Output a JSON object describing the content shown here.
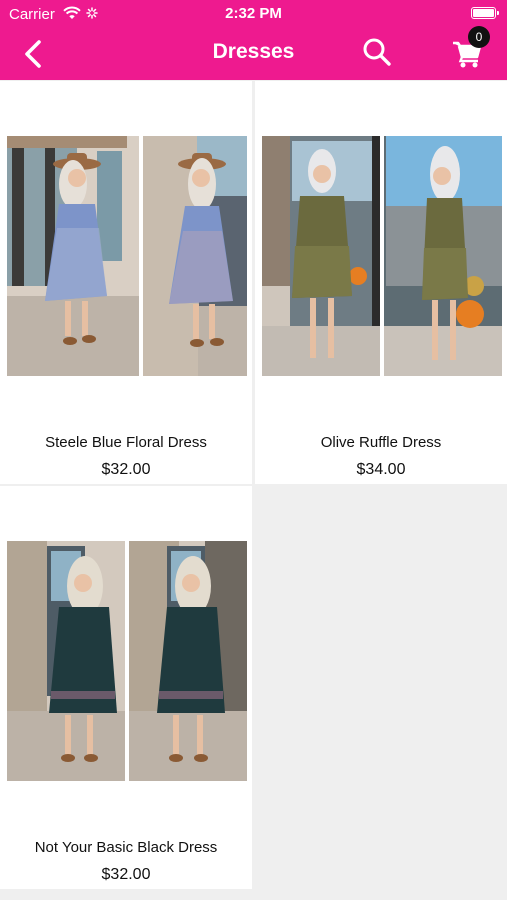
{
  "status_bar": {
    "carrier": "Carrier",
    "time": "2:32 PM",
    "icons": [
      "wifi-icon",
      "activity-icon",
      "battery-icon"
    ]
  },
  "nav": {
    "title": "Dresses",
    "back_icon": "chevron-left-icon",
    "search_icon": "search-icon",
    "cart_icon": "cart-icon",
    "cart_count": "0",
    "accent_color": "#ee1a8f"
  },
  "products": [
    {
      "name": "Steele Blue Floral Dress",
      "price": "$32.00",
      "dress_color": "#7d94c9"
    },
    {
      "name": "Olive Ruffle Dress",
      "price": "$34.00",
      "dress_color": "#6b6a3e"
    },
    {
      "name": "Not Your Basic Black Dress",
      "price": "$32.00",
      "dress_color": "#1f3a3e"
    }
  ]
}
